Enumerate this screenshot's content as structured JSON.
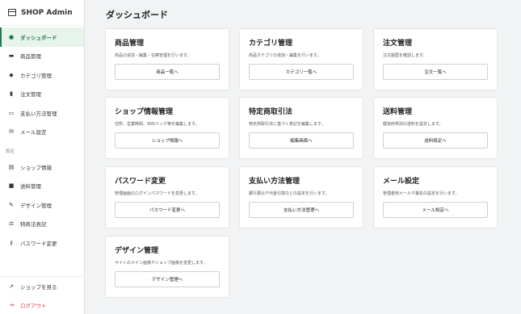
{
  "brand": {
    "name": "SHOP Admin",
    "icon": "shop-icon"
  },
  "nav": {
    "items": [
      {
        "label": "ダッシュボード",
        "icon": "info-icon",
        "active": true
      },
      {
        "label": "商品管理",
        "icon": "box-icon"
      },
      {
        "label": "カテゴリ管理",
        "icon": "tag-icon"
      },
      {
        "label": "注文管理",
        "icon": "document-icon"
      },
      {
        "label": "支払い方法管理",
        "icon": "credit-card-icon"
      },
      {
        "label": "メール設定",
        "icon": "mail-icon"
      }
    ],
    "group_label": "設定",
    "settings_items": [
      {
        "label": "ショップ情報",
        "icon": "store-icon"
      },
      {
        "label": "送料管理",
        "icon": "truck-icon"
      },
      {
        "label": "デザイン管理",
        "icon": "brush-icon"
      },
      {
        "label": "特商法表記",
        "icon": "scale-icon"
      },
      {
        "label": "パスワード変更",
        "icon": "key-icon"
      }
    ],
    "bottom_items": [
      {
        "label": "ショップを見る",
        "icon": "external-link-icon"
      },
      {
        "label": "ログアウト",
        "icon": "logout-icon"
      }
    ]
  },
  "main": {
    "title": "ダッシュボード",
    "cards": [
      {
        "title": "商品管理",
        "desc": "商品の追加・編集・在庫管理を行います。",
        "button": "商品一覧へ"
      },
      {
        "title": "カテゴリ管理",
        "desc": "商品カテゴリの追加・編集を行います。",
        "button": "カテゴリ一覧へ"
      },
      {
        "title": "注文管理",
        "desc": "注文履歴を確認します。",
        "button": "注文一覧へ"
      },
      {
        "title": "ショップ情報管理",
        "desc": "住所、営業時間、SNSリンク等を編集します。",
        "button": "ショップ情報へ"
      },
      {
        "title": "特定商取引法",
        "desc": "特定商取引法に基づく表記を編集します。",
        "button": "編集画面へ"
      },
      {
        "title": "送料管理",
        "desc": "都道府県別の送料を設定します。",
        "button": "送料設定へ"
      },
      {
        "title": "パスワード変更",
        "desc": "管理画面のログインパスワードを変更します。",
        "button": "パスワード変更へ"
      },
      {
        "title": "支払い方法管理",
        "desc": "銀行振込や代金引換などの設定を行います。",
        "button": "支払い方法管理へ"
      },
      {
        "title": "メール設定",
        "desc": "管理者宛メールや署名の設定を行います。",
        "button": "メール設定へ"
      },
      {
        "title": "デザイン管理",
        "desc": "サイトのメイン画像やショップ画像を変更します。",
        "button": "デザイン管理へ"
      }
    ]
  },
  "colors": {
    "accent": "#1e7d4a",
    "active_bg": "#e7f4ec",
    "logout": "#d23a3a",
    "page_bg": "#f1f3f4"
  }
}
